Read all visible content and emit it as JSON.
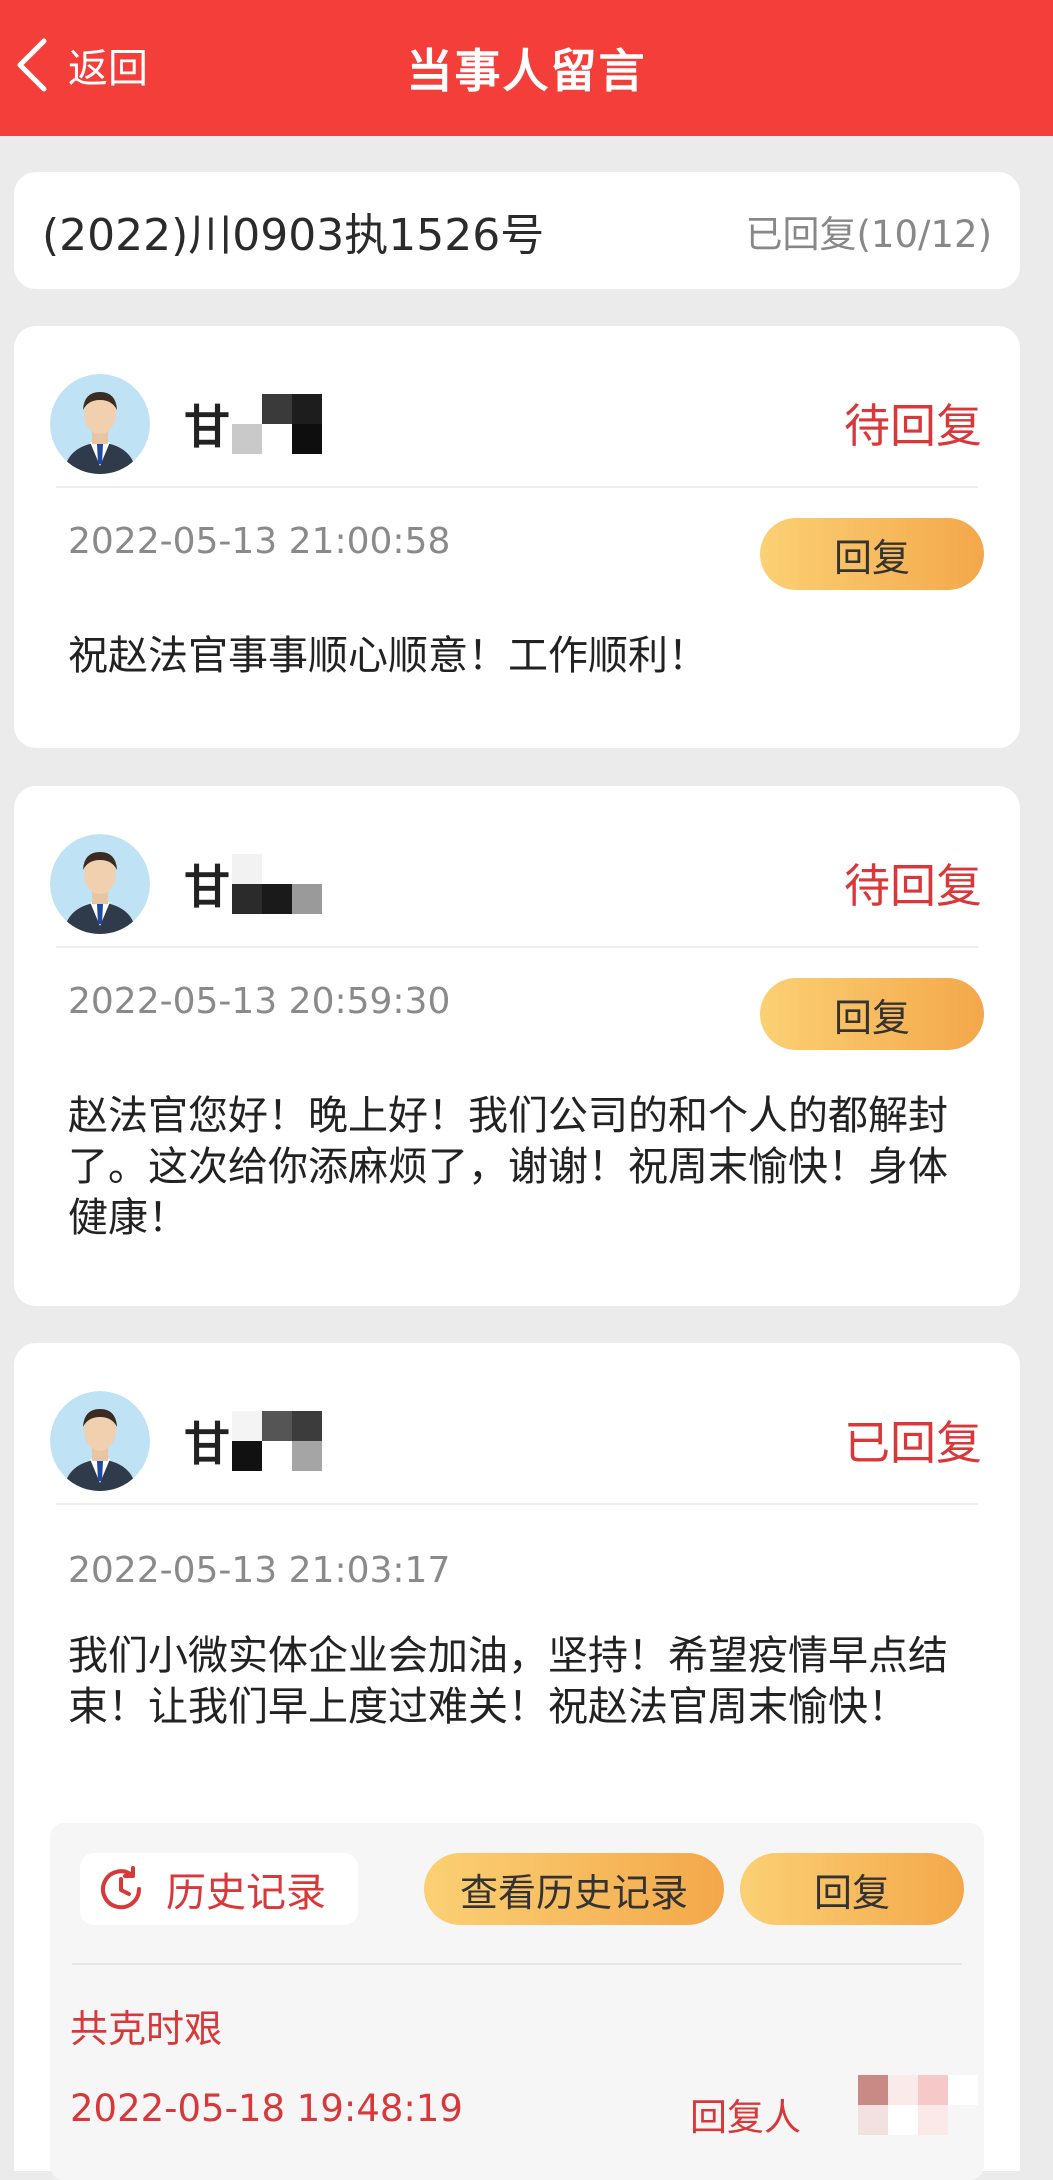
{
  "header": {
    "back_label": "返回",
    "title": "当事人留言"
  },
  "case": {
    "number": "(2022)川0903执1526号",
    "progress": "已回复(10/12)"
  },
  "messages": [
    {
      "user_initial": "甘",
      "status": "待回复",
      "time": "2022-05-13 21:00:58",
      "reply_label": "回复",
      "text": "祝赵法官事事顺心顺意！工作顺利！"
    },
    {
      "user_initial": "甘",
      "status": "待回复",
      "time": "2022-05-13 20:59:30",
      "reply_label": "回复",
      "text": "赵法官您好！晚上好！我们公司的和个人的都解封了。这次给你添麻烦了，谢谢！祝周末愉快！身体健康！"
    },
    {
      "user_initial": "甘",
      "status": "已回复",
      "time": "2022-05-13 21:03:17",
      "text": "我们小微实体企业会加油，坚持！希望疫情早点结束！让我们早上度过难关！祝赵法官周末愉快！",
      "history": {
        "label": "历史记录",
        "view_label": "查看历史记录",
        "reply_label": "回复",
        "reply_text": "共克时艰",
        "reply_time": "2022-05-18 19:48:19",
        "replier_label": "回复人"
      }
    }
  ],
  "colors": {
    "header": "#f43e3a",
    "status": "#d8383a",
    "button_start": "#fbd074",
    "button_end": "#f3a84a"
  }
}
